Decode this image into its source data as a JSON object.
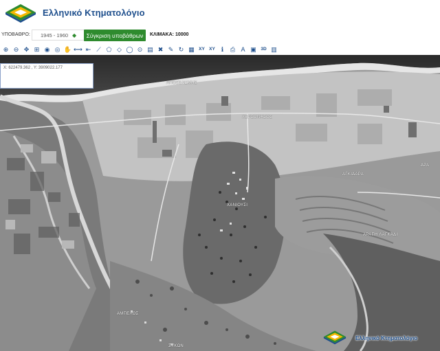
{
  "header": {
    "brand": "Ελληνικό Κτηματολόγιο"
  },
  "controls": {
    "layer_label": "ΥΠΟΒΑΘΡΟ:",
    "year_value": "1945 - 1960",
    "compare_label": "Σύγκριση υποβάθρων",
    "scale_text": "ΚΛΙΜΑΚΑ: 10000"
  },
  "toolbar": {
    "tools": [
      {
        "name": "zoom-in-icon",
        "glyph": "⊕"
      },
      {
        "name": "zoom-out-icon",
        "glyph": "⊖"
      },
      {
        "name": "full-extent-icon",
        "glyph": "✥"
      },
      {
        "name": "zoom-box-icon",
        "glyph": "⊞"
      },
      {
        "name": "zoom-previous-icon",
        "glyph": "◉"
      },
      {
        "name": "zoom-next-icon",
        "glyph": "◎"
      },
      {
        "name": "pan-icon",
        "glyph": "✋"
      },
      {
        "name": "measure-distance-icon",
        "glyph": "⟷"
      },
      {
        "name": "measure-line-icon",
        "glyph": "⇤"
      },
      {
        "name": "draw-line-icon",
        "glyph": "⟋"
      },
      {
        "name": "draw-polygon-icon",
        "glyph": "⬠"
      },
      {
        "name": "draw-area-icon",
        "glyph": "◇"
      },
      {
        "name": "draw-circle-icon",
        "glyph": "◯"
      },
      {
        "name": "target-icon",
        "glyph": "⊙"
      },
      {
        "name": "layers-icon",
        "glyph": "▤"
      },
      {
        "name": "clear-icon",
        "glyph": "✖"
      },
      {
        "name": "edit-icon",
        "glyph": "✎"
      },
      {
        "name": "refresh-icon",
        "glyph": "↻"
      },
      {
        "name": "grid-icon",
        "glyph": "▦"
      },
      {
        "name": "xy-icon",
        "glyph": "XY"
      },
      {
        "name": "xy-goto-icon",
        "glyph": "XY"
      },
      {
        "name": "info-icon",
        "glyph": "ℹ"
      },
      {
        "name": "print-icon",
        "glyph": "⎙"
      },
      {
        "name": "label-icon",
        "glyph": "A"
      },
      {
        "name": "image-icon",
        "glyph": "▣"
      },
      {
        "name": "3d-icon",
        "glyph": "3D"
      },
      {
        "name": "export-icon",
        "glyph": "▥"
      }
    ]
  },
  "coords": {
    "text": "X: 622479.362 , Y: 3909022.177"
  },
  "map_labels": [
    {
      "name": "label-aposelemis",
      "text": "ΑΠΟΣΕΛΕΜΗΣ"
    },
    {
      "name": "label-chersonisos",
      "text": "ΧΕΡΣΟΝΗΣΟΣ"
    },
    {
      "name": "label-agkidara",
      "text": "ΑΓΚΙΔΑΡΑ"
    },
    {
      "name": "label-arapi-lagkadi",
      "text": "ΑΡΑΠΗ ΛΑΓΚΑΔΙ"
    },
    {
      "name": "label-dra",
      "text": "ΔΡΑ"
    },
    {
      "name": "label-chainousi",
      "text": "ΧΑΝΙΟΥΣΙ"
    },
    {
      "name": "label-ambelos",
      "text": "ΑΜΠΕΛΟΣ"
    },
    {
      "name": "label-sykon",
      "text": "ΣΥΚΩΝ"
    }
  ],
  "watermark": {
    "text": "Ελληνικό Κτηματολόγιο"
  }
}
